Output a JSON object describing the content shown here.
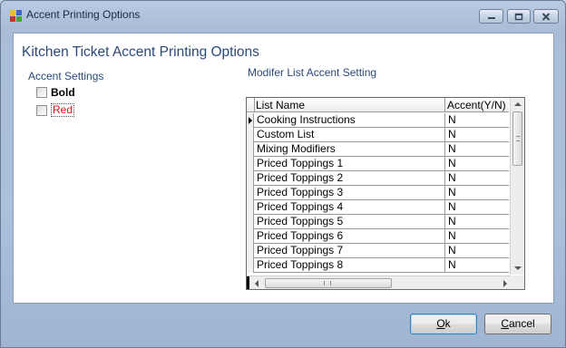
{
  "window": {
    "title": "Accent Printing Options"
  },
  "dialog": {
    "heading": "Kitchen Ticket Accent Printing Options"
  },
  "accent_settings": {
    "label": "Accent Settings",
    "bold": {
      "label": "Bold",
      "checked": false
    },
    "red": {
      "label": "Red",
      "checked": false,
      "color": "#e2101a"
    }
  },
  "modifier": {
    "label": "Modifer List Accent Setting",
    "columns": {
      "name": "List Name",
      "accent": "Accent(Y/N)"
    },
    "rows": [
      {
        "name": "Cooking Instructions",
        "accent": "N"
      },
      {
        "name": "Custom List",
        "accent": "N"
      },
      {
        "name": "Mixing Modifiers",
        "accent": "N"
      },
      {
        "name": "Priced Toppings 1",
        "accent": "N"
      },
      {
        "name": "Priced Toppings 2",
        "accent": "N"
      },
      {
        "name": "Priced Toppings 3",
        "accent": "N"
      },
      {
        "name": "Priced Toppings 4",
        "accent": "N"
      },
      {
        "name": "Priced Toppings 5",
        "accent": "N"
      },
      {
        "name": "Priced Toppings 6",
        "accent": "N"
      },
      {
        "name": "Priced Toppings 7",
        "accent": "N"
      },
      {
        "name": "Priced Toppings 8",
        "accent": "N"
      }
    ]
  },
  "buttons": {
    "ok_first": "O",
    "ok_rest": "k",
    "cancel_first": "C",
    "cancel_rest": "ancel"
  },
  "icons": {
    "app": "app-logo-icon",
    "minimize": "minimize-icon",
    "maximize": "maximize-icon",
    "close": "close-icon"
  }
}
